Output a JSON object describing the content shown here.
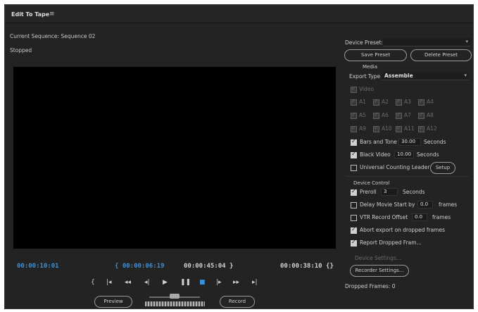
{
  "window": {
    "title": "Edit To Tape",
    "menu_icon": "≡"
  },
  "sequence_label": "Current Sequence: Sequence 02",
  "status_text": "Stopped",
  "timecodes": {
    "in_point": "00:00:10:01",
    "current_left": "{ 00:00:06:19",
    "duration": "00:00:45:04 }",
    "out_point": "00:00:38:10 {}"
  },
  "transport": {
    "buttons": [
      {
        "name": "mark-in-icon",
        "glyph": "{"
      },
      {
        "name": "go-to-in-icon",
        "glyph": "|◂"
      },
      {
        "name": "rewind-icon",
        "glyph": "◂◂"
      },
      {
        "name": "step-back-icon",
        "glyph": "◂|"
      },
      {
        "name": "play-icon",
        "glyph": "▶"
      },
      {
        "name": "pause-icon",
        "glyph": "❚❚"
      },
      {
        "name": "stop-icon",
        "glyph": "■"
      },
      {
        "name": "step-forward-icon",
        "glyph": "|▸"
      },
      {
        "name": "fast-forward-icon",
        "glyph": "▸▸"
      },
      {
        "name": "go-to-out-icon",
        "glyph": "▸|"
      }
    ],
    "preview_label": "Preview",
    "record_label": "Record"
  },
  "right_panel": {
    "device_preset_label": "Device Preset:",
    "device_preset_value": "",
    "save_preset_label": "Save Preset",
    "delete_preset_label": "Delete Preset",
    "media_heading": "Media",
    "export_type_label": "Export Type",
    "export_type_value": "Assemble",
    "video_label": "Video",
    "audio_channels": [
      "A1",
      "A2",
      "A3",
      "A4",
      "A5",
      "A6",
      "A7",
      "A8",
      "A9",
      "A10",
      "A11",
      "A12"
    ],
    "bars_and_tone_label": "Bars and Tone",
    "bars_and_tone_value": "30.00",
    "bars_and_tone_unit": "Seconds",
    "black_video_label": "Black Video",
    "black_video_value": "10.00",
    "black_video_unit": "Seconds",
    "universal_leader_label": "Universal Counting Leader",
    "setup_label": "Setup",
    "device_control_heading": "Device Control",
    "preroll_label": "Preroll",
    "preroll_value": "3",
    "preroll_unit": "Seconds",
    "delay_label": "Delay Movie Start by",
    "delay_value": "0.0",
    "delay_unit": "frames",
    "vtr_offset_label": "VTR Record Offset",
    "vtr_offset_value": "0.0",
    "vtr_offset_unit": "frames",
    "abort_label": "Abort export on dropped frames",
    "report_label": "Report Dropped Fram...",
    "device_settings_label": "Device Settings...",
    "recorder_settings_label": "Recorder Settings...",
    "dropped_frames_label": "Dropped Frames: 0"
  }
}
